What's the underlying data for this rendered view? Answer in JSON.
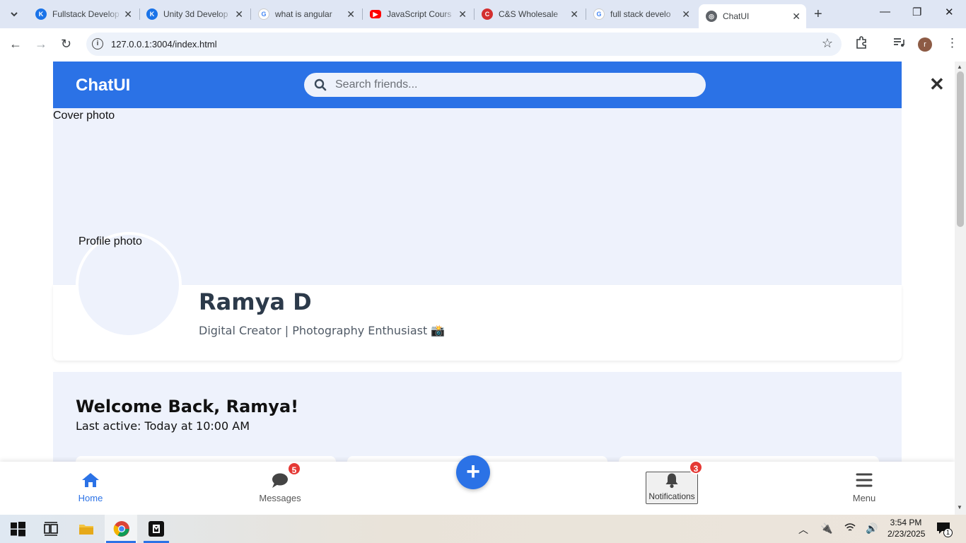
{
  "browser": {
    "tabs": [
      {
        "title": "Fullstack Develop",
        "icon": "knowledge-icon",
        "color": "#1a73e8"
      },
      {
        "title": "Unity 3d Develop",
        "icon": "knowledge-icon",
        "color": "#1a73e8"
      },
      {
        "title": "what is angular",
        "icon": "google-icon",
        "color": "#4285f4"
      },
      {
        "title": "JavaScript Cours",
        "icon": "youtube-icon",
        "color": "#ff0000"
      },
      {
        "title": "C&S Wholesale",
        "icon": "cs-icon",
        "color": "#d32f2f"
      },
      {
        "title": "full stack develo",
        "icon": "google-icon",
        "color": "#4285f4"
      },
      {
        "title": "ChatUI",
        "icon": "globe-icon",
        "color": "#5f6368",
        "active": true
      }
    ],
    "url": "127.0.0.1:3004/index.html",
    "profile_initial": "r"
  },
  "app": {
    "brand": "ChatUI",
    "search_placeholder": "Search friends...",
    "cover_alt": "Cover photo",
    "profile_alt": "Profile photo",
    "name": "Ramya D",
    "bio": "Digital Creator | Photography Enthusiast 📸",
    "welcome_title": "Welcome Back, Ramya!",
    "last_active": "Last active: Today at 10:00 AM",
    "accent": "#2b72e6",
    "nav": {
      "home": "Home",
      "messages": "Messages",
      "messages_badge": "5",
      "fab": "+",
      "notifications": "Notifications",
      "notifications_badge": "3",
      "menu": "Menu"
    }
  },
  "taskbar": {
    "time": "3:54 PM",
    "date": "2/23/2025",
    "notification_count": "1"
  }
}
